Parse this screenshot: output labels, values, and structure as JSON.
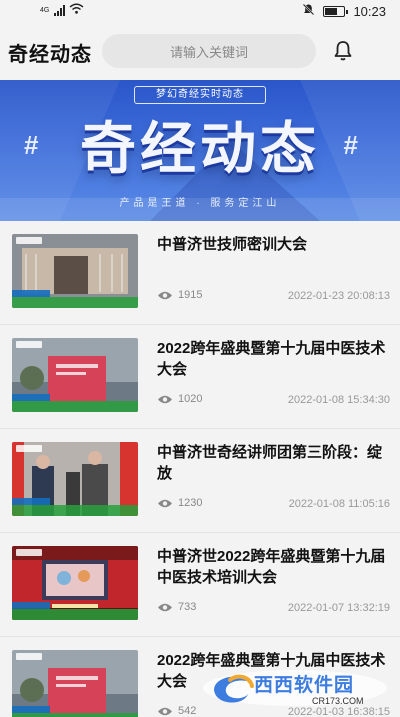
{
  "status_bar": {
    "network": "4G",
    "signal_level": 4,
    "battery_level": 0.7,
    "time": "10:23",
    "icons": [
      "signal-icon",
      "wifi-icon",
      "mute-icon",
      "battery-icon"
    ]
  },
  "header": {
    "title": "奇经动态",
    "search_placeholder": "请输入关键词",
    "bell_icon": "bell-icon"
  },
  "banner": {
    "top_text": "梦幻奇经实时动态",
    "title": "奇经动态",
    "hash_left": "#",
    "hash_right": "#",
    "subtitle": "产品是王道 · 服务定江山"
  },
  "news": [
    {
      "title": "中普济世技师密训大会",
      "views": "1915",
      "date": "2022-01-23 20:08:13",
      "thumb_colors": [
        "#8a8f96",
        "#c7b8a8",
        "#5a4e47"
      ]
    },
    {
      "title": "2022跨年盛典暨第十九届中医技术大会",
      "views": "1020",
      "date": "2022-01-08 15:34:30",
      "thumb_colors": [
        "#9aa4ad",
        "#d64257",
        "#6d7a86"
      ]
    },
    {
      "title": "中普济世奇经讲师团第三阶段：绽放",
      "views": "1230",
      "date": "2022-01-08 11:05:16",
      "thumb_colors": [
        "#b7b2ad",
        "#2d3a52",
        "#d7342f"
      ]
    },
    {
      "title": "中普济世2022跨年盛典暨第十九届中医技术培训大会",
      "views": "733",
      "date": "2022-01-07 13:32:19",
      "thumb_colors": [
        "#7a1a1a",
        "#c0262b",
        "#e8c6c8"
      ]
    },
    {
      "title": "2022跨年盛典暨第十九届中医技术大会",
      "views": "542",
      "date": "2022-01-03 16:38:15",
      "thumb_colors": [
        "#9aa4ad",
        "#d64257",
        "#6d7a86"
      ]
    }
  ],
  "watermark": {
    "text": "西西软件园",
    "url": "CR173.COM"
  },
  "colors": {
    "banner_blue": "#2a56c9",
    "views_gray": "#888888",
    "watermark_blue": "#3d7de0"
  }
}
